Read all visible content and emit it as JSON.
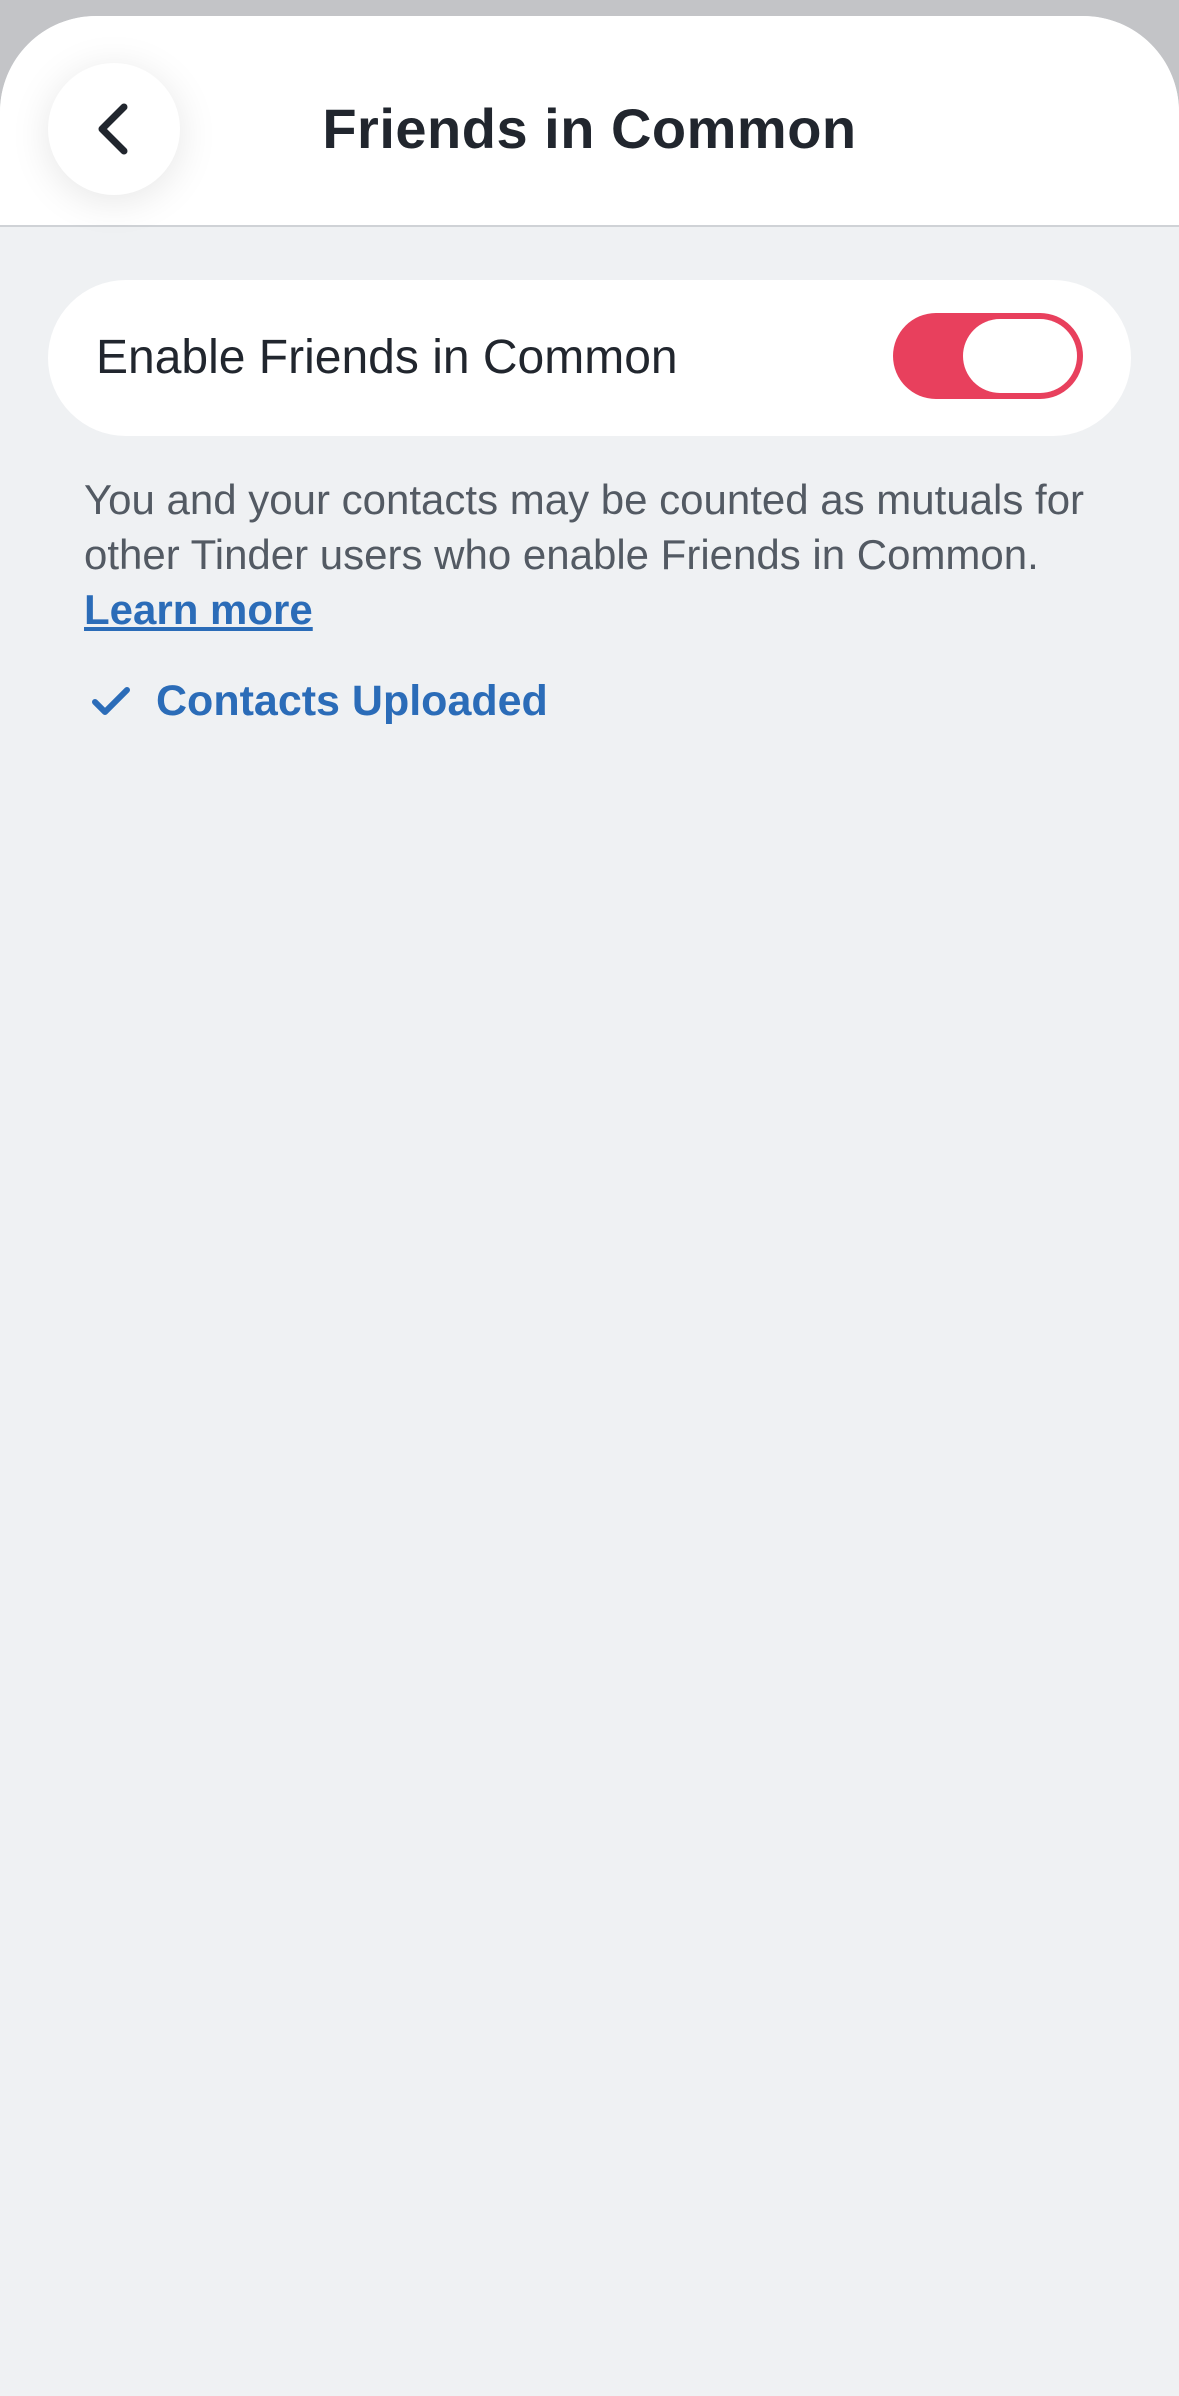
{
  "header": {
    "title": "Friends in Common",
    "back_icon": "chevron-left-icon"
  },
  "toggle": {
    "label": "Enable Friends in Common",
    "enabled": true,
    "on_color": "#e8405d"
  },
  "description": {
    "text": "You and your contacts may be counted as mutuals for other Tinder users who enable Friends in Common.",
    "link_label": "Learn more",
    "link_color": "#2b6cb8"
  },
  "status": {
    "icon": "checkmark-icon",
    "label": "Contacts Uploaded"
  }
}
